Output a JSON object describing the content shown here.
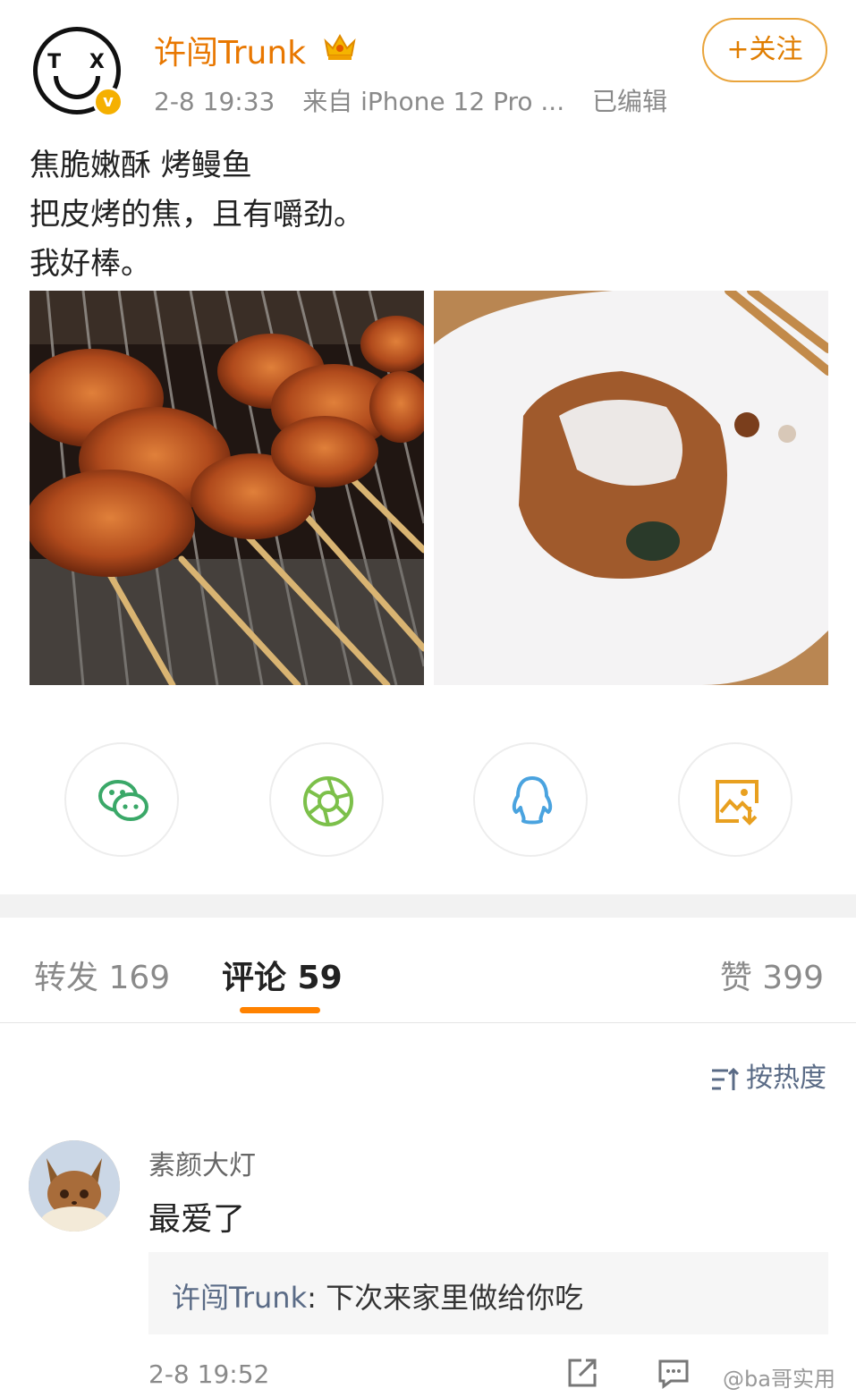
{
  "post": {
    "author": "许闯Trunk",
    "avatar_text": "T X",
    "verified_badge": "v",
    "time": "2-8 19:33",
    "source": "来自 iPhone 12 Pro ...",
    "edited": "已编辑",
    "follow_label": "+关注",
    "text_lines": [
      "焦脆嫩酥 烤鳗鱼",
      "把皮烤的焦，且有嚼劲。",
      "我好棒。"
    ],
    "photos": [
      "grilled-eel-skewers-photo",
      "grilled-eel-on-plate-photo"
    ]
  },
  "share": {
    "items": [
      {
        "icon": "wechat-icon"
      },
      {
        "icon": "moments-icon"
      },
      {
        "icon": "qq-icon"
      },
      {
        "icon": "save-image-icon"
      }
    ]
  },
  "tabs": {
    "repost": "转发 169",
    "comments": "评论 59",
    "likes": "赞 399"
  },
  "sort": {
    "label": "按热度"
  },
  "comment": {
    "name": "素颜大灯",
    "body": "最爱了",
    "reply_author": "许闯Trunk",
    "reply_sep": ": ",
    "reply_text": "下次来家里做给你吃",
    "time": "2-8 19:52"
  },
  "watermark": "@ba哥实用",
  "colors": {
    "accent": "#ff8200",
    "author": "#e87700",
    "link": "#5a6b86"
  }
}
